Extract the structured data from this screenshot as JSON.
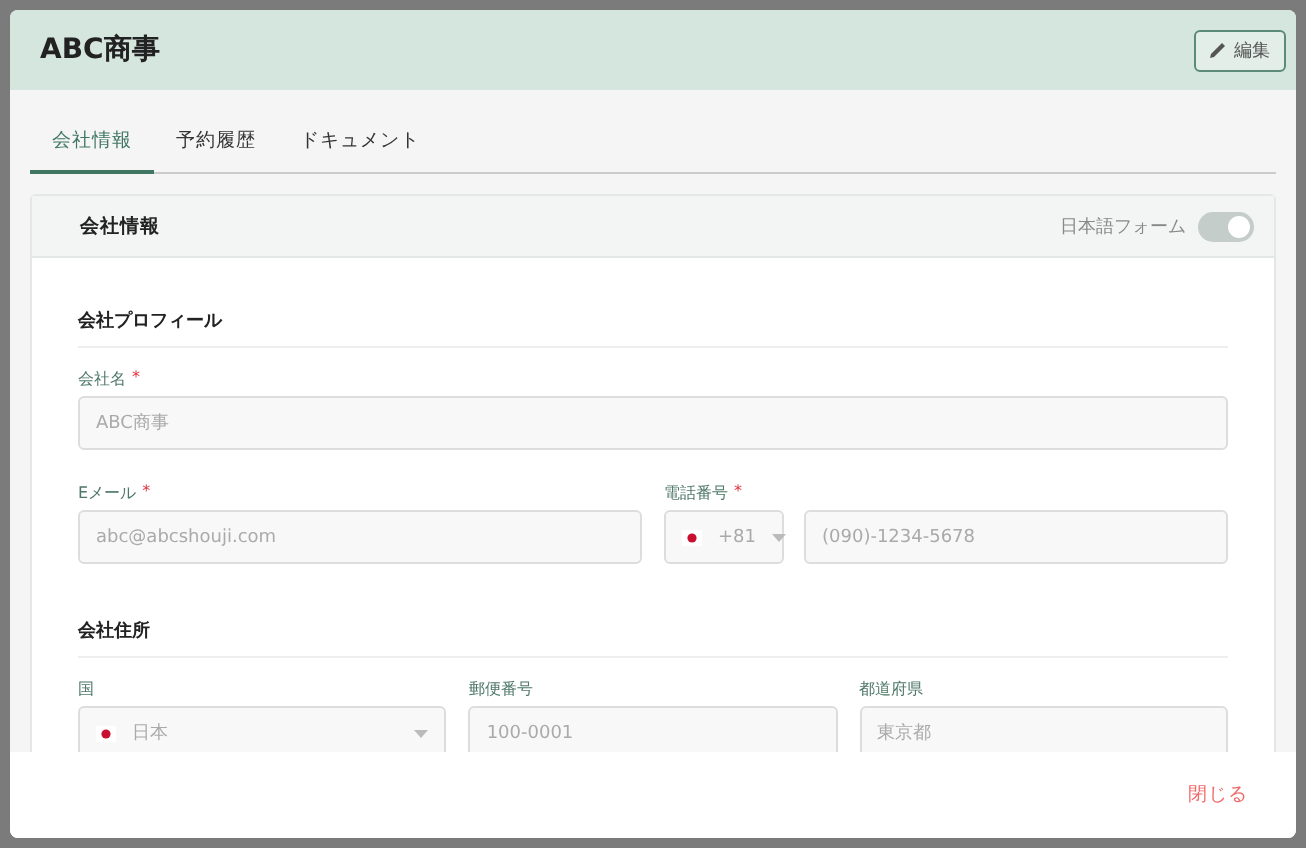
{
  "window": {
    "title": "ABC商事",
    "edit_button": "編集"
  },
  "tabs": [
    {
      "label": "会社情報",
      "selected": true
    },
    {
      "label": "予約履歴",
      "selected": false
    },
    {
      "label": "ドキュメント",
      "selected": false
    }
  ],
  "card": {
    "title": "会社情報",
    "toggle": {
      "label": "日本語フォーム",
      "on": true
    },
    "sections": [
      {
        "title": "会社プロフィール",
        "rows": [
          [
            {
              "kind": "text",
              "label": "会社名",
              "required_mark": "*",
              "disabled": true,
              "value": "ABC商事"
            }
          ],
          [
            {
              "kind": "text",
              "label": "Eメール",
              "required_mark": "*",
              "disabled": true,
              "value": "abc@abcshouji.com"
            },
            {
              "kind": "phone",
              "label": "電話番号",
              "required_mark": "*",
              "disabled": true,
              "code": "+81",
              "value": "(090)-1234-5678"
            }
          ]
        ]
      },
      {
        "title": "会社住所",
        "rows": [
          [
            {
              "kind": "select",
              "label": "国",
              "disabled": true,
              "value": "日本"
            },
            {
              "kind": "text",
              "label": "郵便番号",
              "disabled": true,
              "value": "100-0001"
            },
            {
              "kind": "text",
              "label": "都道府県",
              "disabled": true,
              "value": "東京都"
            }
          ]
        ]
      }
    ]
  },
  "footer": {
    "close_button": "閉じる"
  }
}
